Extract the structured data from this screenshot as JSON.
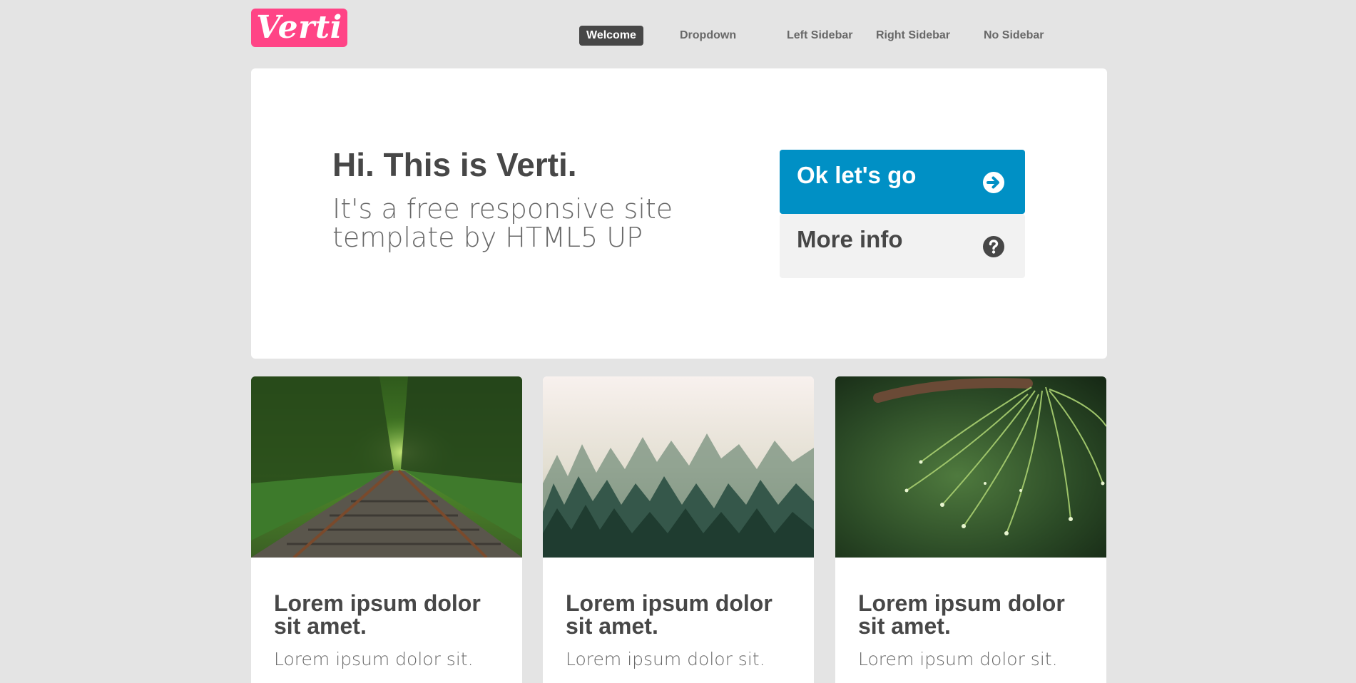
{
  "header": {
    "logo_text": "Verti",
    "nav": [
      {
        "label": "Welcome",
        "active": true
      },
      {
        "label": "Dropdown",
        "active": false
      },
      {
        "label": "Left Sidebar",
        "active": false
      },
      {
        "label": "Right Sidebar",
        "active": false
      },
      {
        "label": "No Sidebar",
        "active": false
      }
    ]
  },
  "banner": {
    "title": "Hi. This is Verti.",
    "subtitle": "It's a free responsive site template by HTML5 UP",
    "buttons": [
      {
        "label": "Ok let's go",
        "icon": "arrow-circle-right-icon"
      },
      {
        "label": "More info",
        "icon": "question-circle-icon"
      }
    ]
  },
  "cards": [
    {
      "image": "railway-through-forest-photo",
      "title": "Lorem ipsum dolor sit amet.",
      "text": "Lorem ipsum dolor sit."
    },
    {
      "image": "misty-pine-forest-photo",
      "title": "Lorem ipsum dolor sit amet.",
      "text": "Lorem ipsum dolor sit."
    },
    {
      "image": "pine-needles-with-droplets-photo",
      "title": "Lorem ipsum dolor sit amet.",
      "text": "Lorem ipsum dolor sit."
    }
  ],
  "colors": {
    "page_background": "#e4e4e4",
    "logo": "#ff4486",
    "primary_button": "#0090c5",
    "secondary_button": "#f2f2f2",
    "text_dark": "#474747",
    "text_muted": "#686868"
  }
}
